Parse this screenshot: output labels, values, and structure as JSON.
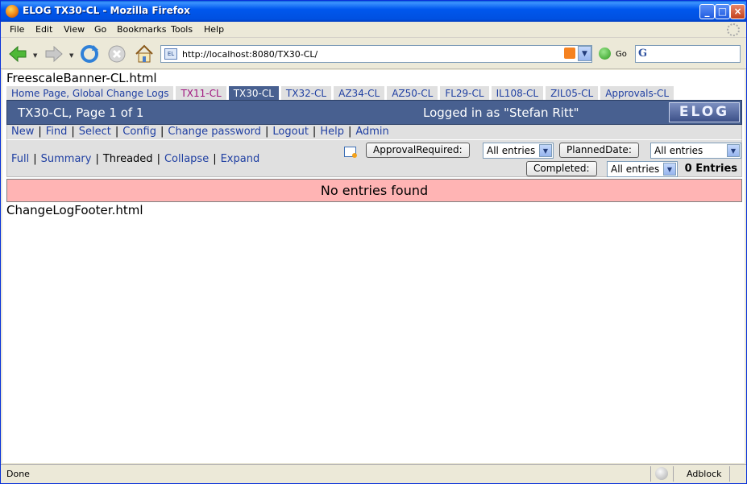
{
  "window": {
    "title": "ELOG TX30-CL - Mozilla Firefox",
    "controls": {
      "minimize": "_",
      "maximize": "□",
      "close": "×"
    }
  },
  "menubar": [
    "File",
    "Edit",
    "View",
    "Go",
    "Bookmarks",
    "Tools",
    "Help"
  ],
  "navbar": {
    "url": "http://localhost:8080/TX30-CL/",
    "favicon_label": "EL",
    "go_label": "Go",
    "search_value": "",
    "search_engine_glyph": "G"
  },
  "page": {
    "banner": "FreescaleBanner-CL.html",
    "tabs": [
      {
        "label": "Home Page, Global Change Logs",
        "state": "normal"
      },
      {
        "label": "TX11-CL",
        "state": "visited"
      },
      {
        "label": "TX30-CL",
        "state": "active"
      },
      {
        "label": "TX32-CL",
        "state": "normal"
      },
      {
        "label": "AZ34-CL",
        "state": "normal"
      },
      {
        "label": "AZ50-CL",
        "state": "normal"
      },
      {
        "label": "FL29-CL",
        "state": "normal"
      },
      {
        "label": "IL108-CL",
        "state": "normal"
      },
      {
        "label": "ZIL05-CL",
        "state": "normal"
      },
      {
        "label": "Approvals-CL",
        "state": "normal"
      }
    ],
    "logbook_title": "TX30-CL, Page 1 of 1",
    "logged_in": "Logged in as \"Stefan Ritt\"",
    "logo": "ELOG",
    "menu": [
      "New",
      "Find",
      "Select",
      "Config",
      "Change password",
      "Logout",
      "Help",
      "Admin"
    ],
    "views": {
      "full": "Full",
      "summary": "Summary",
      "threaded": "Threaded",
      "collapse": "Collapse",
      "expand": "Expand"
    },
    "filters": {
      "approval_button": "ApprovalRequired:",
      "approval_value": "All entries",
      "planned_button": "PlannedDate:",
      "planned_value": "All entries",
      "completed_button": "Completed:",
      "completed_value": "All entries"
    },
    "entries_count": "0 Entries",
    "empty_message": "No entries found",
    "footer": "ChangeLogFooter.html"
  },
  "statusbar": {
    "status": "Done",
    "adblock": "Adblock"
  },
  "colors": {
    "title_bar": "#0058ee",
    "header_bg": "#486090",
    "menu_bg": "#e0e0e0",
    "empty_bg": "#ffb4b4",
    "link": "#1f3fa2",
    "visited_link": "#a0137e"
  }
}
